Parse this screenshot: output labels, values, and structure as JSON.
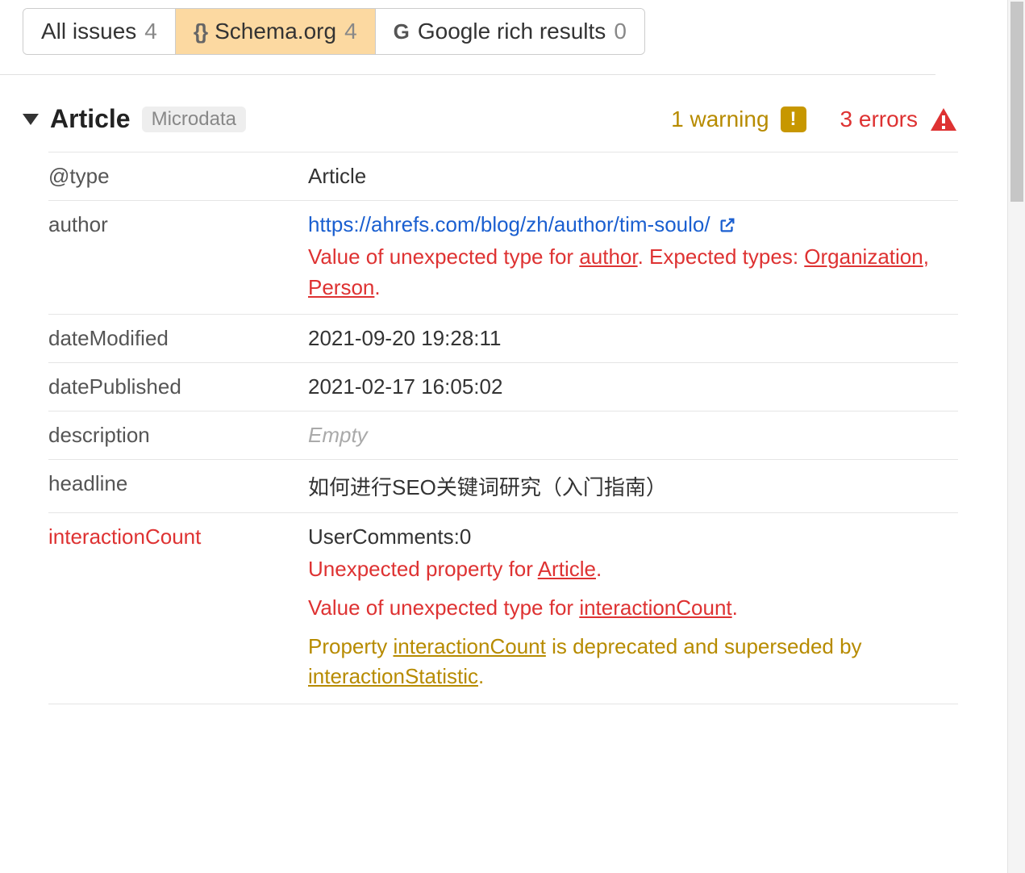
{
  "tabs": [
    {
      "label": "All issues",
      "count": "4"
    },
    {
      "label": "Schema.org",
      "count": "4"
    },
    {
      "label": "Google rich results",
      "count": "0"
    }
  ],
  "section": {
    "title": "Article",
    "badge": "Microdata",
    "warning_text": "1 warning",
    "error_text": "3 errors"
  },
  "rows": {
    "type": {
      "key": "@type",
      "value": "Article"
    },
    "author": {
      "key": "author",
      "url": "https://ahrefs.com/blog/zh/author/tim-soulo/",
      "err_pre": "Value of unexpected type for ",
      "err_link1": "author",
      "err_mid": ". Expected types: ",
      "err_link2": "Organization",
      "err_sep": ", ",
      "err_link3": "Person",
      "err_end": "."
    },
    "dateModified": {
      "key": "dateModified",
      "value": "2021-09-20 19:28:11"
    },
    "datePublished": {
      "key": "datePublished",
      "value": "2021-02-17 16:05:02"
    },
    "description": {
      "key": "description",
      "empty": "Empty"
    },
    "headline": {
      "key": "headline",
      "value": "如何进行SEO关键词研究（入门指南）"
    },
    "interactionCount": {
      "key": "interactionCount",
      "value": "UserComments:0",
      "e1_pre": "Unexpected property for ",
      "e1_link": "Article",
      "e1_end": ".",
      "e2_pre": "Value of unexpected type for ",
      "e2_link": "interactionCount",
      "e2_end": ".",
      "w_pre": "Property ",
      "w_link1": "interactionCount",
      "w_mid": " is deprecated and superseded by ",
      "w_link2": "interactionStatistic",
      "w_end": "."
    }
  }
}
